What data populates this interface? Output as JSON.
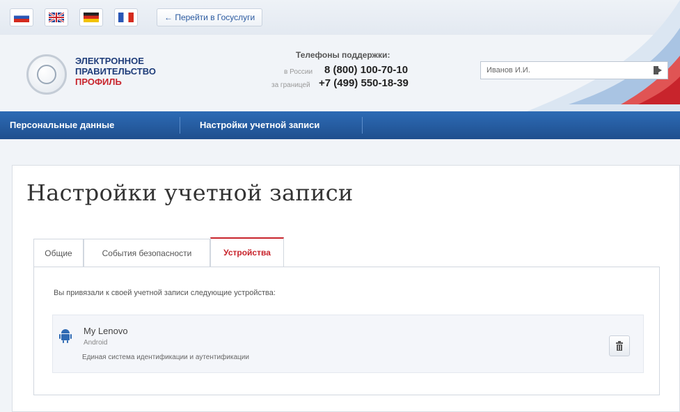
{
  "language_bar": {
    "flags": [
      "Русский",
      "English",
      "Deutsch",
      "Français"
    ],
    "gosuslugi_link": "← Перейти в Госуслуги"
  },
  "header": {
    "logo": {
      "line1": "ЭЛЕКТРОННОЕ",
      "line2": "ПРАВИТЕЛЬСТВО",
      "line3": "ПРОФИЛЬ"
    },
    "support": {
      "title": "Телефоны поддержки:",
      "russia_label": "в России",
      "russia_phone": "8 (800) 100-70-10",
      "abroad_label": "за границей",
      "abroad_phone": "+7 (499) 550-18-39"
    },
    "user": {
      "name": "Иванов И.И."
    }
  },
  "nav": {
    "items": [
      "Персональные данные",
      "Настройки учетной записи"
    ]
  },
  "main": {
    "title": "Настройки учетной записи",
    "tabs": [
      {
        "label": "Общие"
      },
      {
        "label": "События безопасности"
      },
      {
        "label": "Устройства"
      }
    ],
    "intro": "Вы привязали к своей учетной записи следующие устройства:",
    "devices": [
      {
        "name": "My Lenovo",
        "os": "Android",
        "system": "Единая система идентификации и аутентификации"
      }
    ]
  },
  "colors": {
    "nav_blue": "#2d6bb5",
    "accent_red": "#c8242c"
  }
}
